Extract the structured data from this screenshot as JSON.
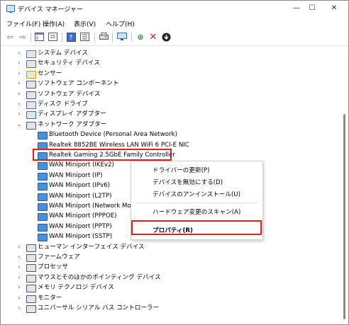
{
  "window": {
    "title": "デバイス マネージャー",
    "minimize": "—",
    "maximize": "☐",
    "close": "✕"
  },
  "menu": [
    "ファイル(F)",
    "操作(A)",
    "表示(V)",
    "ヘルプ(H)"
  ],
  "toolbar": [
    "back-icon",
    "forward-icon",
    "show-hide-icon",
    "properties-icon",
    "help-icon",
    "properties-view-icon",
    "print-icon",
    "monitor-icon",
    "enable-device-icon",
    "uninstall-icon",
    "update-icon"
  ],
  "tree": [
    {
      "label": "システム デバイス",
      "expander": "›"
    },
    {
      "label": "セキュリティ デバイス",
      "expander": "›"
    },
    {
      "label": "センサー",
      "expander": "›"
    },
    {
      "label": "ソフトウェア コンポーネント",
      "expander": "›"
    },
    {
      "label": "ソフトウェア デバイス",
      "expander": "›"
    },
    {
      "label": "ディスク ドライブ",
      "expander": "›"
    },
    {
      "label": "ディスプレイ アダプター",
      "expander": "›"
    },
    {
      "label": "ネットワーク アダプター",
      "expander": "⌄"
    },
    {
      "label": "Bluetooth Device (Personal Area Network)",
      "expander": ""
    },
    {
      "label": "Realtek 8852BE Wireless LAN WiFi 6 PCI-E NIC",
      "expander": ""
    },
    {
      "label": "Realtek Gaming 2.5GbE Family Controller",
      "expander": ""
    },
    {
      "label": "WAN Miniport (IKEv2)",
      "expander": ""
    },
    {
      "label": "WAN Miniport (IP)",
      "expander": ""
    },
    {
      "label": "WAN Miniport (IPv6)",
      "expander": ""
    },
    {
      "label": "WAN Miniport (L2TP)",
      "expander": ""
    },
    {
      "label": "WAN Miniport (Network Mo",
      "expander": ""
    },
    {
      "label": "WAN Miniport (PPPOE)",
      "expander": ""
    },
    {
      "label": "WAN Miniport (PPTP)",
      "expander": ""
    },
    {
      "label": "WAN Miniport (SSTP)",
      "expander": ""
    },
    {
      "label": "ヒューマン インターフェイス デバイス",
      "expander": "›"
    },
    {
      "label": "ファームウェア",
      "expander": "›"
    },
    {
      "label": "プロセッサ",
      "expander": "›"
    },
    {
      "label": "マウスとそのほかのポインティング デバイス",
      "expander": "›"
    },
    {
      "label": "メモリ テクノロジ デバイス",
      "expander": "›"
    },
    {
      "label": "モニター",
      "expander": "›"
    },
    {
      "label": "ユニバーサル シリアル バス コントローラー",
      "expander": "›"
    }
  ],
  "context_menu": {
    "items": [
      "ドライバーの更新(P)",
      "デバイスを無効にする(D)",
      "デバイスのアンインストール(U)",
      "ハードウェア変更のスキャン(A)",
      "プロパティ(R)"
    ]
  }
}
